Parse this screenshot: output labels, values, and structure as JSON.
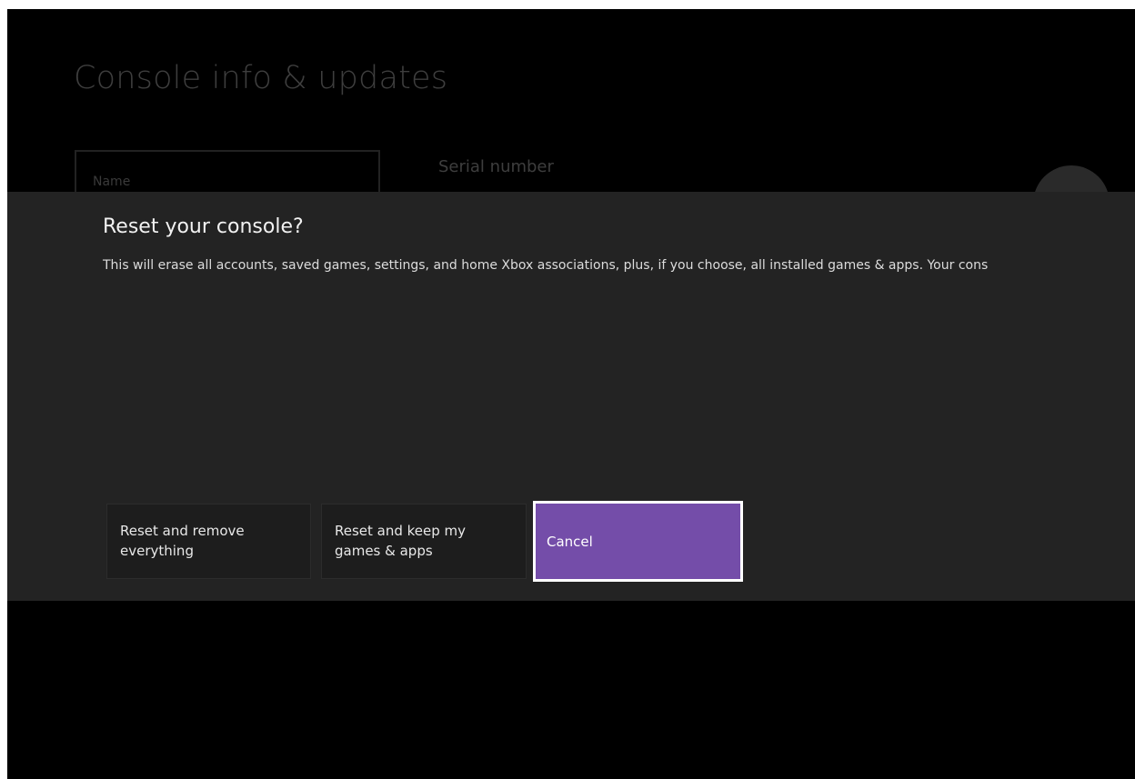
{
  "background_page": {
    "title": "Console info & updates",
    "name_field_label": "Name",
    "serial_number_label": "Serial number"
  },
  "dialog": {
    "title": "Reset your console?",
    "message": "This will erase all accounts, saved games, settings, and home Xbox associations, plus, if you choose, all installed games & apps. Your cons",
    "buttons": {
      "reset_remove": "Reset and remove everything",
      "reset_keep": "Reset and keep my games & apps",
      "cancel": "Cancel"
    }
  },
  "colors": {
    "screen_background": "#000000",
    "dialog_background": "#232323",
    "focused_button": "#744da9",
    "focus_border": "#ffffff"
  },
  "icons": [
    "xbox-logo-icon"
  ]
}
